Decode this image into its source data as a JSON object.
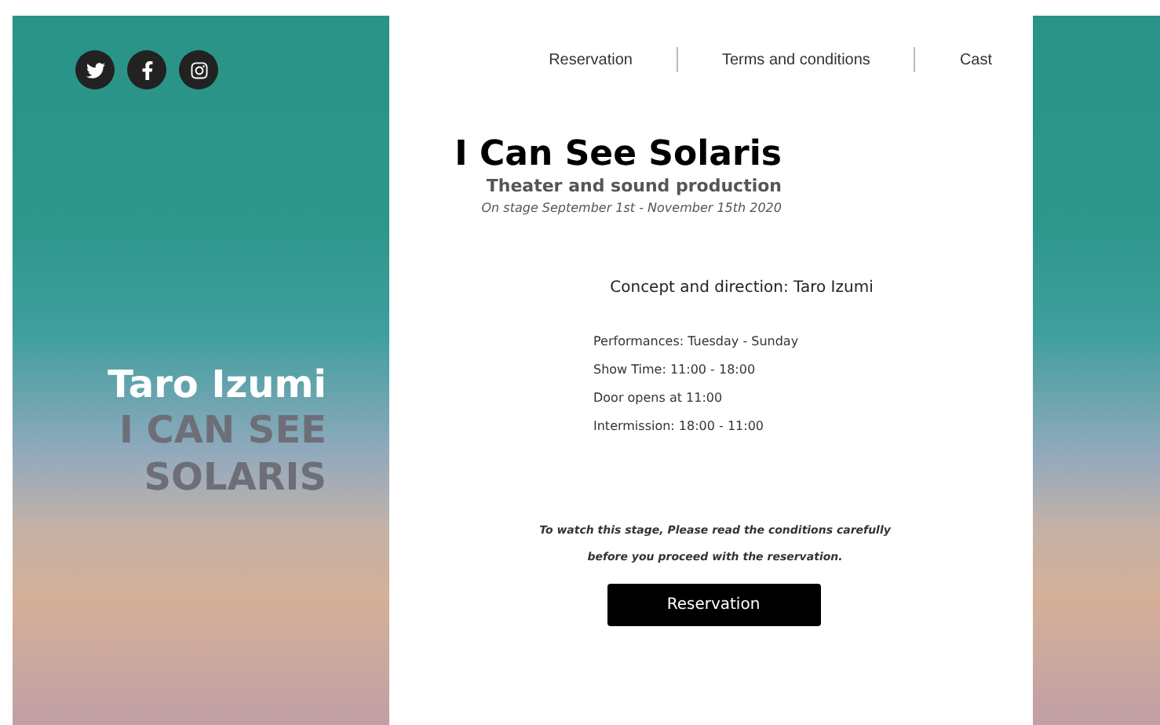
{
  "nav": [
    {
      "label": "Reservation"
    },
    {
      "label": "Terms and conditions"
    },
    {
      "label": "Cast"
    }
  ],
  "side": {
    "name": "Taro Izumi",
    "title_lines": [
      "I CAN SEE",
      "SOLARIS"
    ]
  },
  "hero": {
    "title": "I Can See Solaris",
    "subtitle": "Theater and sound production",
    "dates": "On stage September 1st - November 15th 2020"
  },
  "credit": "Concept and direction: Taro Izumi",
  "schedule": [
    "Performances: Tuesday - Sunday",
    "Show Time: 11:00 - 18:00",
    "Door opens at 11:00",
    "Intermission: 18:00 - 11:00"
  ],
  "notice": [
    "To watch this stage, Please read the conditions carefully",
    "before you proceed with the reservation."
  ],
  "button": "Reservation"
}
